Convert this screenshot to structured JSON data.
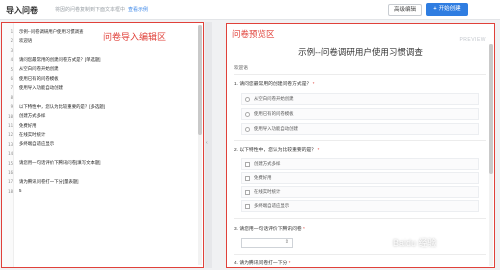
{
  "header": {
    "title": "导入问卷",
    "hint": "将因的问卷复制到下面文本框中",
    "hint_link": "查看示例",
    "advanced_edit": "高级编辑",
    "generate": "开始创建",
    "generate_icon": "plus-icon"
  },
  "editor": {
    "label": "问卷导入编辑区",
    "lines": [
      {
        "n": "1",
        "text": "示例--问卷调研用户使用习惯调查"
      },
      {
        "n": "2",
        "text": "欢迎语"
      },
      {
        "n": "3",
        "text": ""
      },
      {
        "n": "4",
        "text": "请问您最常用的创建问卷方式是？[单选题]"
      },
      {
        "n": "5",
        "text": "从空白问卷开始创建"
      },
      {
        "n": "6",
        "text": "使用已有的问卷模板"
      },
      {
        "n": "7",
        "text": "使用导入功能自动创建"
      },
      {
        "n": "8",
        "text": ""
      },
      {
        "n": "9",
        "text": "以下特性中，您认为比较重要的是？[多选题]"
      },
      {
        "n": "10",
        "text": "创建方式多样"
      },
      {
        "n": "11",
        "text": "免费好用"
      },
      {
        "n": "12",
        "text": "在线实时统计"
      },
      {
        "n": "13",
        "text": "多终端自适应显示"
      },
      {
        "n": "14",
        "text": ""
      },
      {
        "n": "15",
        "text": "请您用一句话评价下腾讯问卷[填写文本题]"
      },
      {
        "n": "16",
        "text": ""
      },
      {
        "n": "17",
        "text": "请为腾讯问卷打一下分[量表题]"
      },
      {
        "n": "18",
        "text": "5"
      }
    ]
  },
  "preview": {
    "label": "问卷预览区",
    "badge": "PREVIEW",
    "survey_title": "示例--问卷调研用户使用习惯调查",
    "welcome": "欢迎语",
    "q1": {
      "title": "1. 请问您最常用的创建问卷方式是？",
      "required": "*",
      "options": [
        "从空白问卷开始创建",
        "使用已有的问卷模板",
        "使用导入功能自动创建"
      ]
    },
    "q2": {
      "title": "2. 以下特性中，您认为比较重要的是？",
      "required": "*",
      "options": [
        "创建方式多样",
        "免费好用",
        "在线实时统计",
        "多终端自适应显示"
      ]
    },
    "q3": {
      "title": "3. 请您用一句话评价下腾讯问卷",
      "required": "*",
      "select_value": ""
    },
    "q4": {
      "title": "4. 请为腾讯问卷打一下分",
      "required": "*"
    }
  },
  "watermark": "Baidu 经验"
}
